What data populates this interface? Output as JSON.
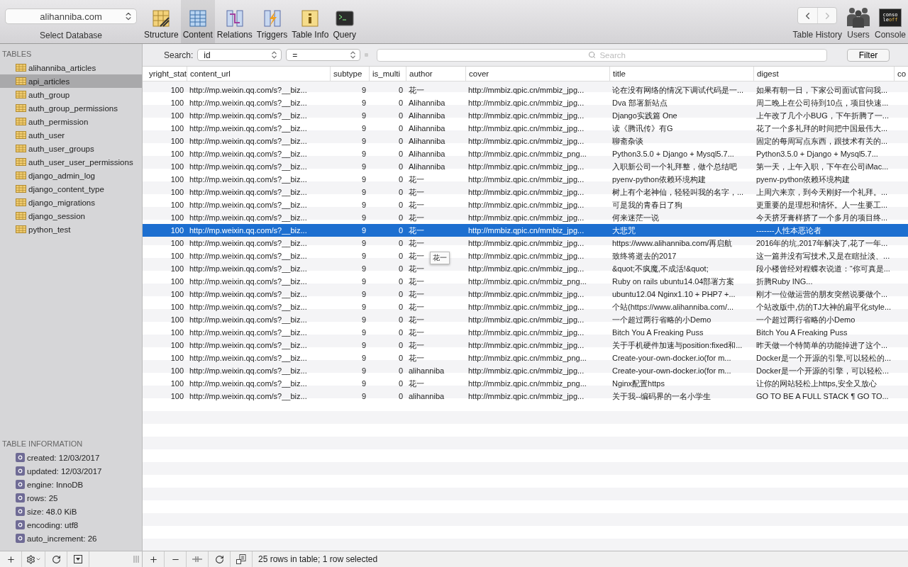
{
  "toolbar": {
    "database": "alihanniba.com",
    "database_label": "Select Database",
    "tabs": [
      {
        "label": "Structure",
        "kind": "structure",
        "selected": false
      },
      {
        "label": "Content",
        "kind": "content",
        "selected": true
      },
      {
        "label": "Relations",
        "kind": "relations",
        "selected": false
      },
      {
        "label": "Triggers",
        "kind": "triggers",
        "selected": false
      },
      {
        "label": "Table Info",
        "kind": "info",
        "selected": false
      },
      {
        "label": "Query",
        "kind": "query",
        "selected": false
      }
    ],
    "history_label": "Table History",
    "users_label": "Users",
    "console_label": "Console",
    "console_badge": [
      "conso",
      "le",
      "off"
    ]
  },
  "sidebar": {
    "heading": "TABLES",
    "tables": [
      {
        "name": "alihanniba_articles",
        "selected": false
      },
      {
        "name": "api_articles",
        "selected": true
      },
      {
        "name": "auth_group",
        "selected": false
      },
      {
        "name": "auth_group_permissions",
        "selected": false
      },
      {
        "name": "auth_permission",
        "selected": false
      },
      {
        "name": "auth_user",
        "selected": false
      },
      {
        "name": "auth_user_groups",
        "selected": false
      },
      {
        "name": "auth_user_user_permissions",
        "selected": false
      },
      {
        "name": "django_admin_log",
        "selected": false
      },
      {
        "name": "django_content_type",
        "selected": false
      },
      {
        "name": "django_migrations",
        "selected": false
      },
      {
        "name": "django_session",
        "selected": false
      },
      {
        "name": "python_test",
        "selected": false
      }
    ],
    "info_heading": "TABLE INFORMATION",
    "info": [
      "created: 12/03/2017",
      "updated: 12/03/2017",
      "engine: InnoDB",
      "rows: 25",
      "size: 48.0 KiB",
      "encoding: utf8",
      "auto_increment: 26"
    ]
  },
  "filter": {
    "label": "Search:",
    "field": "id",
    "operator": "=",
    "placeholder": "Search",
    "button": "Filter"
  },
  "table": {
    "columns": [
      "yright_stat",
      "content_url",
      "subtype",
      "is_multi",
      "author",
      "cover",
      "title",
      "digest",
      "co"
    ],
    "rows": [
      {
        "selected": false,
        "cells": [
          "100",
          "http://mp.weixin.qq.com/s?__biz...",
          "9",
          "0",
          "花一",
          "http://mmbiz.qpic.cn/mmbiz_jpg...",
          "论在没有网络的情况下调试代码是一...",
          "如果有朝一日，下家公司面试官问我..."
        ]
      },
      {
        "selected": false,
        "cells": [
          "100",
          "http://mp.weixin.qq.com/s?__biz...",
          "9",
          "0",
          "Alihanniba",
          "http://mmbiz.qpic.cn/mmbiz_jpg...",
          "Dva 部署新站点",
          "周二晚上在公司待到10点，项目快速..."
        ]
      },
      {
        "selected": false,
        "cells": [
          "100",
          "http://mp.weixin.qq.com/s?__biz...",
          "9",
          "0",
          "Alihanniba",
          "http://mmbiz.qpic.cn/mmbiz_jpg...",
          "Django实践篇 One",
          "上午改了几个小BUG，下午折腾了一..."
        ]
      },
      {
        "selected": false,
        "cells": [
          "100",
          "http://mp.weixin.qq.com/s?__biz...",
          "9",
          "0",
          "Alihanniba",
          "http://mmbiz.qpic.cn/mmbiz_jpg...",
          "读《腾讯传》有G",
          "花了一个多礼拜的时间把中国最伟大..."
        ]
      },
      {
        "selected": false,
        "cells": [
          "100",
          "http://mp.weixin.qq.com/s?__biz...",
          "9",
          "0",
          "Alihanniba",
          "http://mmbiz.qpic.cn/mmbiz_jpg...",
          "聊斋杂谈",
          "固定的每周写点东西，跟技术有关的..."
        ]
      },
      {
        "selected": false,
        "cells": [
          "100",
          "http://mp.weixin.qq.com/s?__biz...",
          "9",
          "0",
          "Alihanniba",
          "http://mmbiz.qpic.cn/mmbiz_png...",
          "Python3.5.0 + Django + Mysql5.7...",
          "Python3.5.0 + Django + Mysql5.7..."
        ]
      },
      {
        "selected": false,
        "cells": [
          "100",
          "http://mp.weixin.qq.com/s?__biz...",
          "9",
          "0",
          "Alihanniba",
          "http://mmbiz.qpic.cn/mmbiz_jpg...",
          "入职新公司一个礼拜整，做个总结吧",
          "第一天，上午入职，下午在公司iMac..."
        ]
      },
      {
        "selected": false,
        "cells": [
          "100",
          "http://mp.weixin.qq.com/s?__biz...",
          "9",
          "0",
          "花一",
          "http://mmbiz.qpic.cn/mmbiz_jpg...",
          "pyenv-python依赖环境构建",
          "pyenv-python依赖环境构建"
        ]
      },
      {
        "selected": false,
        "cells": [
          "100",
          "http://mp.weixin.qq.com/s?__biz...",
          "9",
          "0",
          "花一",
          "http://mmbiz.qpic.cn/mmbiz_jpg...",
          "树上有个老神仙，轻轻叫我的名字，...",
          "上周六来京，到今天刚好一个礼拜。..."
        ]
      },
      {
        "selected": false,
        "cells": [
          "100",
          "http://mp.weixin.qq.com/s?__biz...",
          "9",
          "0",
          "花一",
          "http://mmbiz.qpic.cn/mmbiz_jpg...",
          "可是我的青春日了狗",
          "更重要的是理想和情怀。人一生要工..."
        ]
      },
      {
        "selected": false,
        "cells": [
          "100",
          "http://mp.weixin.qq.com/s?__biz...",
          "9",
          "0",
          "花一",
          "http://mmbiz.qpic.cn/mmbiz_jpg...",
          "何来迷茫一说",
          "今天挤牙膏样挤了一个多月的项目终..."
        ]
      },
      {
        "selected": true,
        "cells": [
          "100",
          "http://mp.weixin.qq.com/s?__biz...",
          "9",
          "0",
          "花一",
          "http://mmbiz.qpic.cn/mmbiz_jpg...",
          "大悲咒",
          "-------人性本恶论者"
        ]
      },
      {
        "selected": false,
        "cells": [
          "100",
          "http://mp.weixin.qq.com/s?__biz...",
          "9",
          "0",
          "花一",
          "http://mmbiz.qpic.cn/mmbiz_jpg...",
          "https://www.alihanniba.com/再启航",
          "2016年的坑,2017年解决了,花了一年..."
        ]
      },
      {
        "selected": false,
        "tooltip": "花一",
        "cells": [
          "100",
          "http://mp.weixin.qq.com/s?__biz...",
          "9",
          "0",
          "花一",
          "http://mmbiz.qpic.cn/mmbiz_jpg...",
          "致终将逝去的2017",
          "这一篇并没有写技术,又是在瞎扯淡、..."
        ]
      },
      {
        "selected": false,
        "cells": [
          "100",
          "http://mp.weixin.qq.com/s?__biz...",
          "9",
          "0",
          "花一",
          "http://mmbiz.qpic.cn/mmbiz_jpg...",
          "&quot;不疯魔,不成活!&quot;",
          "段小楼曾经对程蝶衣说道：“你可真是..."
        ]
      },
      {
        "selected": false,
        "cells": [
          "100",
          "http://mp.weixin.qq.com/s?__biz...",
          "9",
          "0",
          "花一",
          "http://mmbiz.qpic.cn/mmbiz_png...",
          "Ruby on rails ubuntu14.04部署方案",
          "折腾Ruby   ING..."
        ]
      },
      {
        "selected": false,
        "cells": [
          "100",
          "http://mp.weixin.qq.com/s?__biz...",
          "9",
          "0",
          "花一",
          "http://mmbiz.qpic.cn/mmbiz_jpg...",
          "ubuntu12.04 Nginx1.10 + PHP7 +...",
          "刚才一位做运营的朋友突然说要做个..."
        ]
      },
      {
        "selected": false,
        "cells": [
          "100",
          "http://mp.weixin.qq.com/s?__biz...",
          "9",
          "0",
          "花一",
          "http://mmbiz.qpic.cn/mmbiz_jpg...",
          "个站(https://www.alihanniba.com/...",
          "个站改版中,仿的TJ大神的扁平化style..."
        ]
      },
      {
        "selected": false,
        "cells": [
          "100",
          "http://mp.weixin.qq.com/s?__biz...",
          "9",
          "0",
          "花一",
          "http://mmbiz.qpic.cn/mmbiz_jpg...",
          "一个超过两行省略的小Demo",
          "一个超过两行省略的小Demo"
        ]
      },
      {
        "selected": false,
        "cells": [
          "100",
          "http://mp.weixin.qq.com/s?__biz...",
          "9",
          "0",
          "花一",
          "http://mmbiz.qpic.cn/mmbiz_jpg...",
          "Bitch You A Freaking Puss",
          "Bitch You A Freaking Puss"
        ]
      },
      {
        "selected": false,
        "cells": [
          "100",
          "http://mp.weixin.qq.com/s?__biz...",
          "9",
          "0",
          "花一",
          "http://mmbiz.qpic.cn/mmbiz_jpg...",
          "关于手机硬件加速与position:fixed和...",
          "昨天做一个特简单的功能掉进了这个..."
        ]
      },
      {
        "selected": false,
        "cells": [
          "100",
          "http://mp.weixin.qq.com/s?__biz...",
          "9",
          "0",
          "花一",
          "http://mmbiz.qpic.cn/mmbiz_png...",
          "Create-your-own-docker.io(for m...",
          "Docker是一个开源的引擎,可以轻松的..."
        ]
      },
      {
        "selected": false,
        "cells": [
          "100",
          "http://mp.weixin.qq.com/s?__biz...",
          "9",
          "0",
          "alihanniba",
          "http://mmbiz.qpic.cn/mmbiz_jpg...",
          "Create-your-own-docker.io(for m...",
          "Docker是一个开源的引擎，可以轻松..."
        ]
      },
      {
        "selected": false,
        "cells": [
          "100",
          "http://mp.weixin.qq.com/s?__biz...",
          "9",
          "0",
          "花一",
          "http://mmbiz.qpic.cn/mmbiz_png...",
          "Nginx配置https",
          "让你的网站轻松上https,安全又放心"
        ]
      },
      {
        "selected": false,
        "cells": [
          "100",
          "http://mp.weixin.qq.com/s?__biz...",
          "9",
          "0",
          "alihanniba",
          "http://mmbiz.qpic.cn/mmbiz_jpg...",
          "关于我--编码界的一名小学生",
          "GO TO BE A FULL STACK ¶ GO TO..."
        ]
      }
    ]
  },
  "status": "25 rows in table; 1 row selected"
}
